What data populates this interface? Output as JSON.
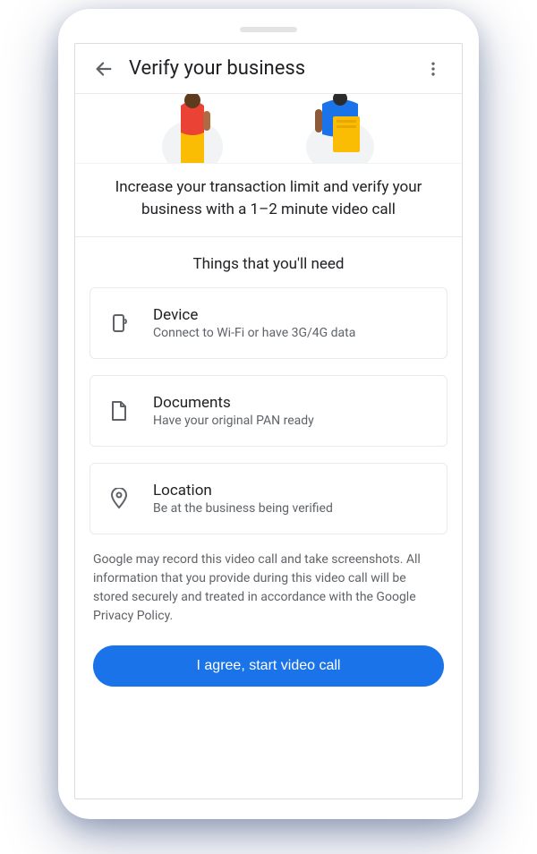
{
  "appBar": {
    "title": "Verify your business"
  },
  "intro": "Increase your transaction limit and verify your business with a 1–2 minute video call",
  "sectionTitle": "Things that you'll need",
  "cards": [
    {
      "title": "Device",
      "sub": "Connect to Wi-Fi or have 3G/4G data"
    },
    {
      "title": "Documents",
      "sub": "Have your original PAN ready"
    },
    {
      "title": "Location",
      "sub": "Be at the business being verified"
    }
  ],
  "disclosure": "Google may record this video call and take screenshots. All information that you provide during this video call will be stored securely and treated in accordance with the Google Privacy Policy.",
  "cta": "I agree, start video call"
}
